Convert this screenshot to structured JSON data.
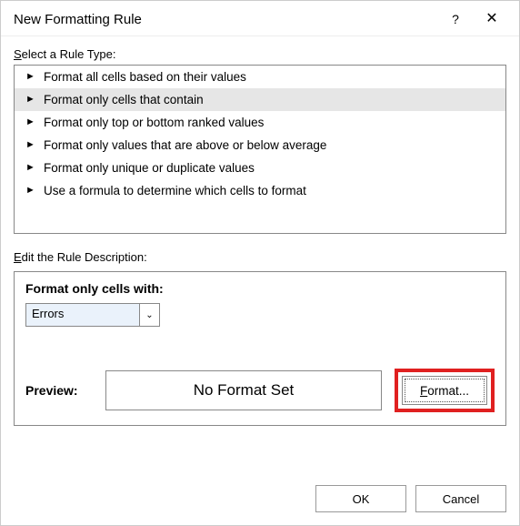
{
  "titlebar": {
    "title": "New Formatting Rule",
    "help_symbol": "?",
    "close_symbol": "✕"
  },
  "labels": {
    "select_rule_prefix": "S",
    "select_rule_rest": "elect a Rule Type:",
    "edit_desc_prefix": "E",
    "edit_desc_rest": "dit the Rule Description:",
    "format_with": "Format only cells with:",
    "preview": "Preview:",
    "no_format": "No Format Set",
    "format_btn_prefix": "F",
    "format_btn_rest": "ormat..."
  },
  "rule_types": [
    {
      "text": "Format all cells based on their values",
      "selected": false
    },
    {
      "text": "Format only cells that contain",
      "selected": true
    },
    {
      "text": "Format only top or bottom ranked values",
      "selected": false
    },
    {
      "text": "Format only values that are above or below average",
      "selected": false
    },
    {
      "text": "Format only unique or duplicate values",
      "selected": false
    },
    {
      "text": "Use a formula to determine which cells to format",
      "selected": false
    }
  ],
  "combo": {
    "value": "Errors",
    "arrow": "⌄"
  },
  "footer": {
    "ok": "OK",
    "cancel": "Cancel"
  },
  "icons": {
    "pointer": "►"
  }
}
